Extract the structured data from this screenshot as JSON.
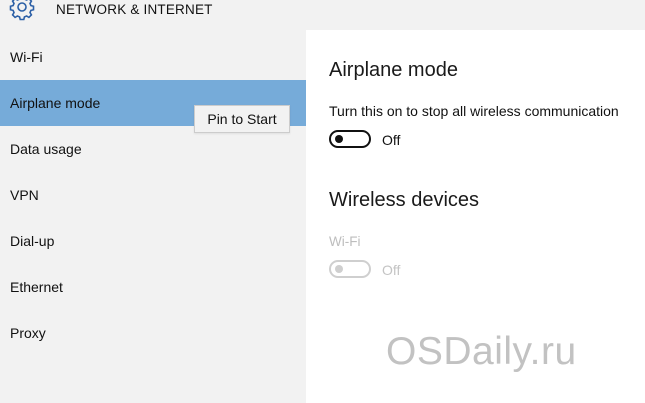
{
  "header": {
    "title": "NETWORK & INTERNET",
    "icon": "gear-icon"
  },
  "sidebar": {
    "items": [
      {
        "label": "Wi-Fi"
      },
      {
        "label": "Airplane mode",
        "selected": true
      },
      {
        "label": "Data usage"
      },
      {
        "label": "VPN"
      },
      {
        "label": "Dial-up"
      },
      {
        "label": "Ethernet"
      },
      {
        "label": "Proxy"
      }
    ],
    "selected_color": "#76abd9"
  },
  "tooltip": {
    "label": "Pin to Start"
  },
  "main": {
    "airplane": {
      "title": "Airplane mode",
      "description": "Turn this on to stop all wireless communication",
      "toggle_state": "Off",
      "toggle_on": false
    },
    "wireless": {
      "title": "Wireless devices",
      "wifi_label": "Wi-Fi",
      "wifi_state": "Off",
      "wifi_enabled": false
    }
  },
  "watermark": {
    "text": "OSDaily.ru"
  }
}
